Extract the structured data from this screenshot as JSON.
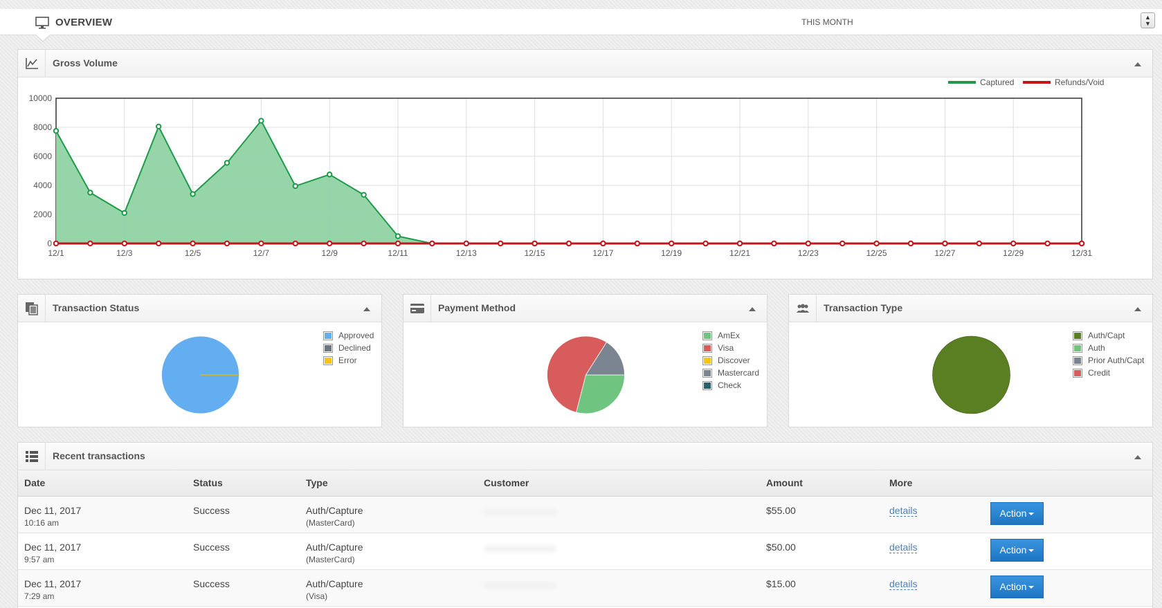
{
  "header": {
    "title": "OVERVIEW",
    "period": "THIS MONTH"
  },
  "gross_volume": {
    "title": "Gross Volume",
    "legend": [
      {
        "name": "Captured",
        "color": "#1e9a4a"
      },
      {
        "name": "Refunds/Void",
        "color": "#c0161c"
      }
    ]
  },
  "chart_data": {
    "type": "area",
    "title": "Gross Volume",
    "x_labels": [
      "12/1",
      "12/3",
      "12/5",
      "12/7",
      "12/9",
      "12/11",
      "12/13",
      "12/15",
      "12/17",
      "12/19",
      "12/21",
      "12/23",
      "12/25",
      "12/27",
      "12/29",
      "12/31"
    ],
    "x": [
      "12/1",
      "12/2",
      "12/3",
      "12/4",
      "12/5",
      "12/6",
      "12/7",
      "12/8",
      "12/9",
      "12/10",
      "12/11",
      "12/12",
      "12/13",
      "12/14",
      "12/15",
      "12/16",
      "12/17",
      "12/18",
      "12/19",
      "12/20",
      "12/21",
      "12/22",
      "12/23",
      "12/24",
      "12/25",
      "12/26",
      "12/27",
      "12/28",
      "12/29",
      "12/30",
      "12/31"
    ],
    "yticks": [
      0,
      2000,
      4000,
      6000,
      8000,
      10000
    ],
    "ylim": [
      0,
      10000
    ],
    "grid": true,
    "legend_position": "top-right",
    "series": [
      {
        "name": "Captured",
        "color": "#1e9a4a",
        "fill": "#8fd3a3",
        "values": [
          7750,
          3500,
          2100,
          8050,
          3400,
          5550,
          8450,
          3950,
          4750,
          3350,
          500,
          0,
          0,
          0,
          0,
          0,
          0,
          0,
          0,
          0,
          0,
          0,
          0,
          0,
          0,
          0,
          0,
          0,
          0,
          0,
          0
        ]
      },
      {
        "name": "Refunds/Void",
        "color": "#c0161c",
        "values": [
          0,
          0,
          0,
          0,
          0,
          0,
          0,
          0,
          0,
          0,
          0,
          0,
          0,
          0,
          0,
          0,
          0,
          0,
          0,
          0,
          0,
          0,
          0,
          0,
          0,
          0,
          0,
          0,
          0,
          0,
          0
        ]
      }
    ]
  },
  "pies": {
    "status": {
      "title": "Transaction Status",
      "legend": [
        {
          "label": "Approved",
          "color": "#62aef0"
        },
        {
          "label": "Declined",
          "color": "#6d7580"
        },
        {
          "label": "Error",
          "color": "#f5c518"
        }
      ],
      "slices": [
        {
          "label": "Approved",
          "value": 99.9,
          "color": "#62aef0"
        },
        {
          "label": "Error",
          "value": 0.1,
          "color": "#c8b23a"
        }
      ]
    },
    "payment": {
      "title": "Payment Method",
      "legend": [
        {
          "label": "AmEx",
          "color": "#6fc47f"
        },
        {
          "label": "Visa",
          "color": "#d95c5c"
        },
        {
          "label": "Discover",
          "color": "#f5c518"
        },
        {
          "label": "Mastercard",
          "color": "#7b8491"
        },
        {
          "label": "Check",
          "color": "#285f6e"
        }
      ],
      "slices": [
        {
          "label": "AmEx",
          "value": 29,
          "color": "#6fc47f"
        },
        {
          "label": "Visa",
          "value": 55,
          "color": "#d95c5c"
        },
        {
          "label": "Mastercard",
          "value": 16,
          "color": "#7b8491"
        }
      ]
    },
    "ttype": {
      "title": "Transaction Type",
      "legend": [
        {
          "label": "Auth/Capt",
          "color": "#5a7f22"
        },
        {
          "label": "Auth",
          "color": "#6fc47f"
        },
        {
          "label": "Prior Auth/Capt",
          "color": "#7b8491"
        },
        {
          "label": "Credit",
          "color": "#d95c5c"
        }
      ],
      "slices": [
        {
          "label": "Auth/Capt",
          "value": 100,
          "color": "#5a7f22"
        }
      ]
    }
  },
  "recent": {
    "title": "Recent transactions",
    "columns": [
      "Date",
      "Status",
      "Type",
      "Customer",
      "Amount",
      "More"
    ],
    "details_label": "details",
    "action_label": "Action",
    "rows": [
      {
        "date": "Dec 11, 2017",
        "time": "10:16 am",
        "status": "Success",
        "type": "Auth/Capture",
        "card": "(MasterCard)",
        "amount": "$55.00"
      },
      {
        "date": "Dec 11, 2017",
        "time": "9:57 am",
        "status": "Success",
        "type": "Auth/Capture",
        "card": "(MasterCard)",
        "amount": "$50.00"
      },
      {
        "date": "Dec 11, 2017",
        "time": "7:29 am",
        "status": "Success",
        "type": "Auth/Capture",
        "card": "(Visa)",
        "amount": "$15.00"
      }
    ]
  }
}
